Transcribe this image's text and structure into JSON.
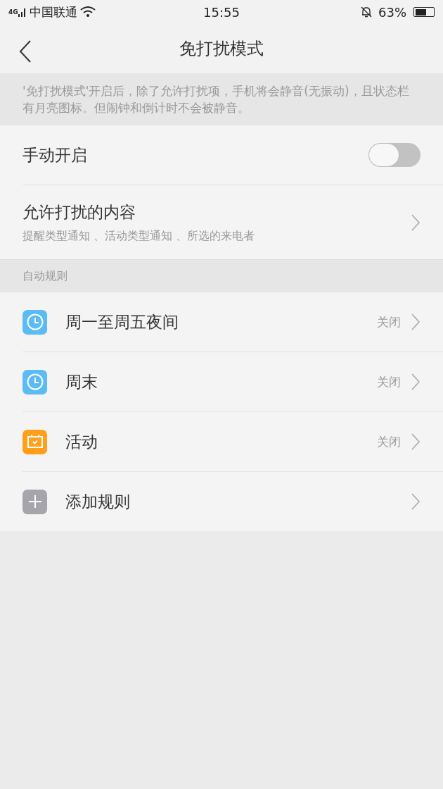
{
  "status_bar": {
    "network": "4G",
    "carrier": "中国联通",
    "time": "15:55",
    "battery_text": "63%"
  },
  "header": {
    "title": "免打扰模式"
  },
  "note": "'免打扰模式'开启后，除了允许打扰项，手机将会静音(无振动)，且状态栏有月亮图标。但闹钟和倒计时不会被静音。",
  "manual": {
    "label": "手动开启",
    "on": false
  },
  "allowed": {
    "title": "允许打扰的内容",
    "subtitle": "提醒类型通知 、活动类型通知 、所选的来电者"
  },
  "section": {
    "title": "自动规则"
  },
  "rules": [
    {
      "kind": "clock",
      "color": "#5bbcf5",
      "label": "周一至周五夜间",
      "status": "关闭"
    },
    {
      "kind": "clock",
      "color": "#5bbcf5",
      "label": "周末",
      "status": "关闭"
    },
    {
      "kind": "calendar",
      "color": "#ff9f1a",
      "label": "活动",
      "status": "关闭"
    },
    {
      "kind": "add",
      "color": "#a6a5ab",
      "label": "添加规则"
    }
  ]
}
